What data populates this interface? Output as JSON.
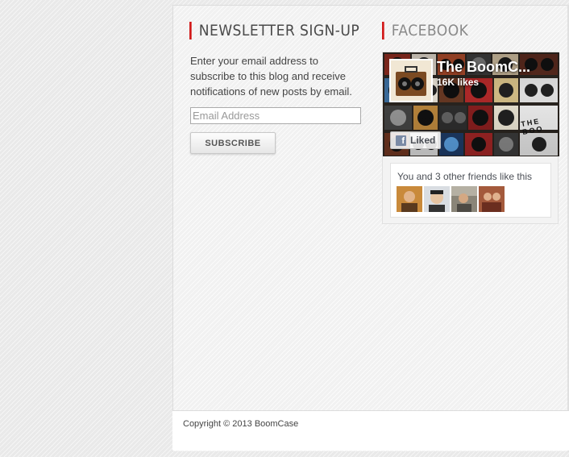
{
  "newsletter": {
    "title": "NEWSLETTER SIGN-UP",
    "description": "Enter your email address to subscribe to this blog and receive notifications of new posts by email.",
    "email_placeholder": "Email Address",
    "subscribe_label": "SUBSCRIBE"
  },
  "facebook": {
    "title": "FACEBOOK",
    "page_name": "The BoomC...",
    "likes": "16K likes",
    "liked_label": "Liked",
    "cover_text": "THE BOO",
    "friends_text": "You and 3 other friends like this",
    "friend_avatars": [
      "friend-avatar-1",
      "friend-avatar-2",
      "friend-avatar-3",
      "friend-avatar-4"
    ]
  },
  "footer": {
    "copyright": "Copyright © 2013 BoomCase"
  },
  "colors": {
    "accent": "#d21a1a",
    "background": "#e9e9e9",
    "panel": "#f1f1f1"
  }
}
